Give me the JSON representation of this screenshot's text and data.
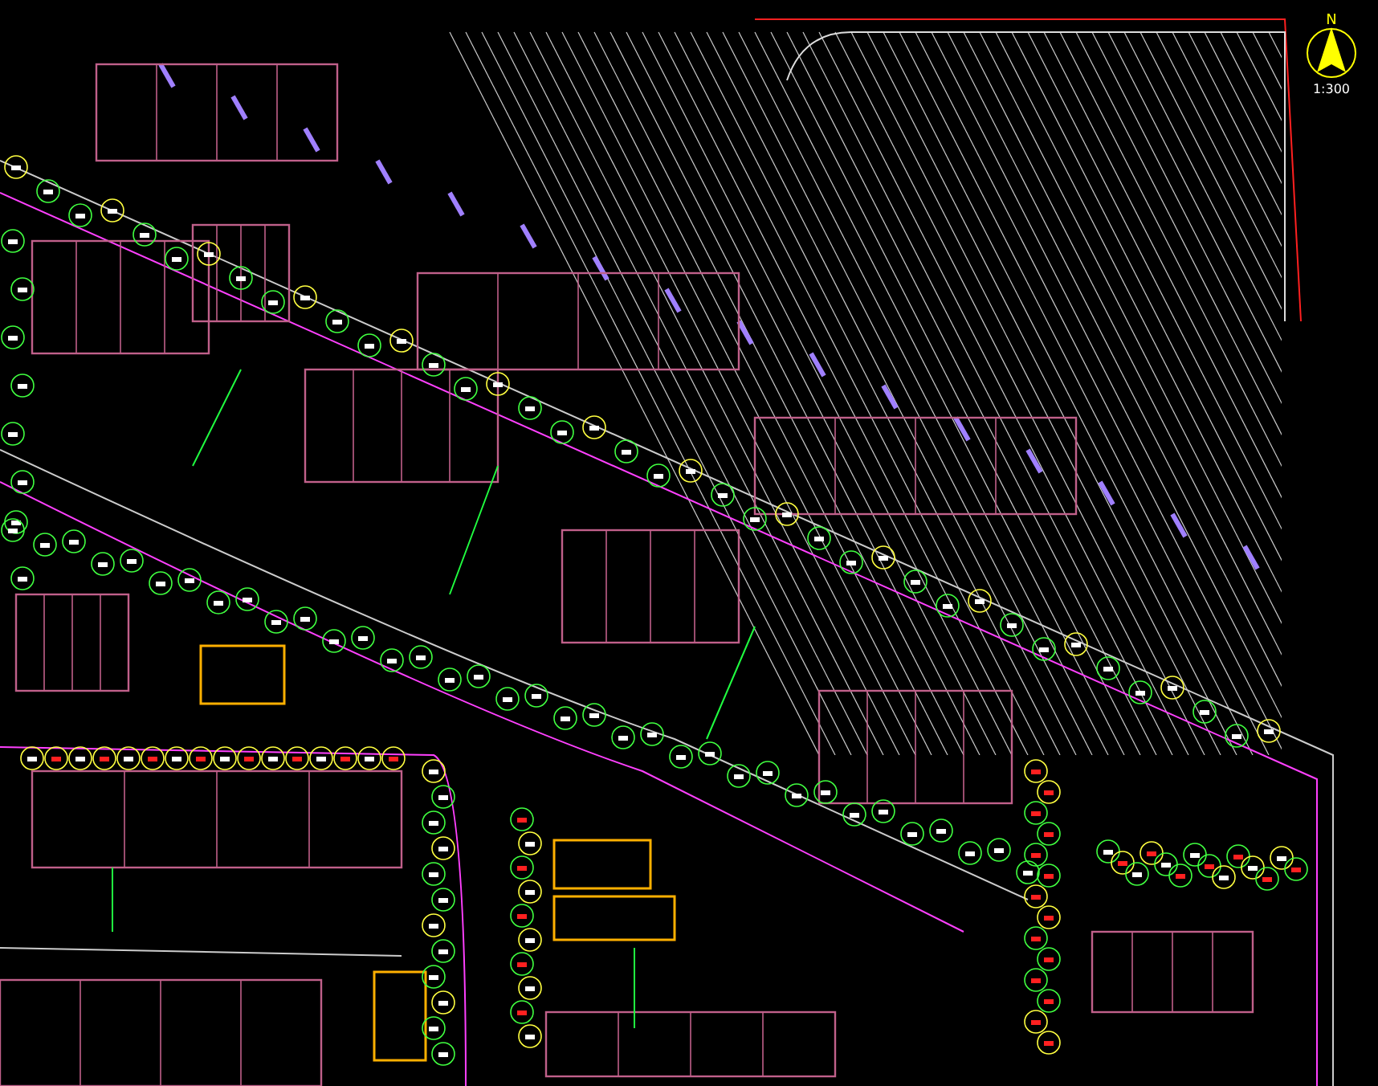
{
  "north_arrow": {
    "label": "N",
    "scale": "1:300"
  }
}
